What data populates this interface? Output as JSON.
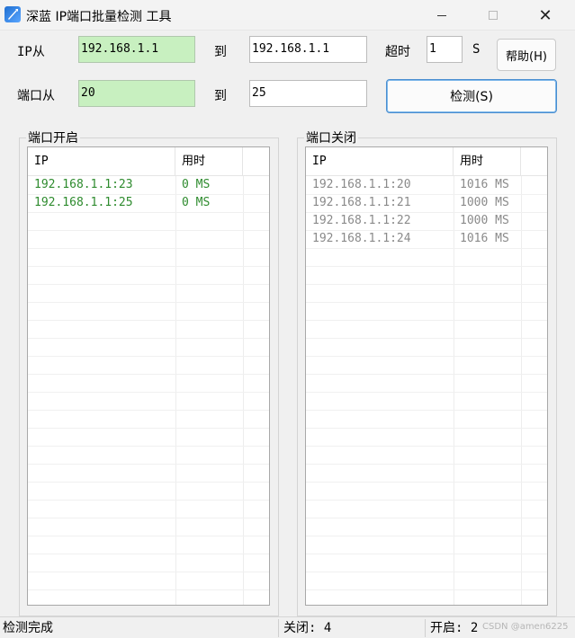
{
  "window": {
    "title": "深蓝 IP端口批量检测 工具",
    "min_label": "",
    "close_label": "✕"
  },
  "form": {
    "ip_from_label": "IP从",
    "ip_from_value": "192.168.1.1",
    "ip_to_label": "到",
    "ip_to_value": "192.168.1.1",
    "timeout_label": "超时",
    "timeout_value": "1",
    "timeout_unit": "S",
    "help_button": "帮助(H)",
    "port_from_label": "端口从",
    "port_from_value": "20",
    "port_to_label": "到",
    "port_to_value": "25",
    "detect_button": "检测(S)"
  },
  "open_panel": {
    "title": "端口开启",
    "columns": [
      "IP",
      "用时"
    ],
    "rows": [
      [
        "192.168.1.1:23",
        "0 MS"
      ],
      [
        "192.168.1.1:25",
        "0 MS"
      ]
    ]
  },
  "closed_panel": {
    "title": "端口关闭",
    "columns": [
      "IP",
      "用时"
    ],
    "rows": [
      [
        "192.168.1.1:20",
        "1016 MS"
      ],
      [
        "192.168.1.1:21",
        "1000 MS"
      ],
      [
        "192.168.1.1:22",
        "1000 MS"
      ],
      [
        "192.168.1.1:24",
        "1016 MS"
      ]
    ]
  },
  "status": {
    "message": "检测完成",
    "closed_count": "关闭: 4",
    "open_count": "开启: 2",
    "watermark": "CSDN @amen6225"
  },
  "colors": {
    "open_text": "#2e8b2e",
    "closed_text": "#8a8a8a",
    "input_highlight": "#c8f0c0",
    "primary_border": "#4a8ed0"
  }
}
